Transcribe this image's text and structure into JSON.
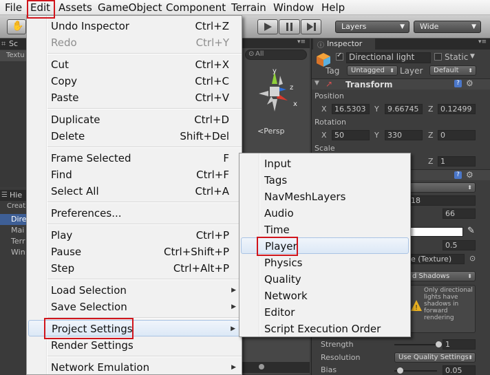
{
  "menubar": {
    "items": [
      "File",
      "Edit",
      "Assets",
      "GameObject",
      "Component",
      "Terrain",
      "Window",
      "Help"
    ]
  },
  "toolbar": {
    "layers_label": "Layers",
    "layout_label": "Wide"
  },
  "left_panels": {
    "scene_tab": "Sc",
    "scene_sub": "Textu",
    "hierarchy_tab": "Hie",
    "hierarchy_create": "Creat",
    "hierarchy_items": [
      "Dire",
      "Mai",
      "Terr",
      "Win"
    ]
  },
  "scene_view": {
    "search_placeholder": "All",
    "axis_y": "y",
    "axis_z": "z",
    "axis_x": "x",
    "persp_label": "Persp"
  },
  "inspector": {
    "tab_title": "Inspector",
    "object_name": "Directional light",
    "static_label": "Static",
    "tag_label": "Tag",
    "tag_value": "Untagged",
    "layer_label": "Layer",
    "layer_value": "Default",
    "transform_title": "Transform",
    "position_label": "Position",
    "position": {
      "x": "16.5303",
      "y": "9.66745",
      "z": "0.12499"
    },
    "rotation_label": "Rotation",
    "rotation": {
      "x": "50",
      "y": "330",
      "z": "0"
    },
    "scale_label": "Scale",
    "scale_z": "1",
    "light_range_value": "18",
    "intensity_value": "66",
    "spot_value": "0.5",
    "cookie_texture": "e (Texture)",
    "shadows_value": "d Shadows",
    "shadow_warning": "Only directional lights have shadows in forward rendering",
    "strength_label": "Strength",
    "strength_value": "1",
    "resolution_label": "Resolution",
    "resolution_value": "Use Quality Settings",
    "bias_label": "Bias",
    "bias_value": "0.05"
  },
  "edit_menu": {
    "undo": {
      "label": "Undo Inspector",
      "shortcut": "Ctrl+Z"
    },
    "redo": {
      "label": "Redo",
      "shortcut": "Ctrl+Y"
    },
    "cut": {
      "label": "Cut",
      "shortcut": "Ctrl+X"
    },
    "copy": {
      "label": "Copy",
      "shortcut": "Ctrl+C"
    },
    "paste": {
      "label": "Paste",
      "shortcut": "Ctrl+V"
    },
    "duplicate": {
      "label": "Duplicate",
      "shortcut": "Ctrl+D"
    },
    "delete": {
      "label": "Delete",
      "shortcut": "Shift+Del"
    },
    "frame_selected": {
      "label": "Frame Selected",
      "shortcut": "F"
    },
    "find": {
      "label": "Find",
      "shortcut": "Ctrl+F"
    },
    "select_all": {
      "label": "Select All",
      "shortcut": "Ctrl+A"
    },
    "preferences": {
      "label": "Preferences..."
    },
    "play": {
      "label": "Play",
      "shortcut": "Ctrl+P"
    },
    "pause": {
      "label": "Pause",
      "shortcut": "Ctrl+Shift+P"
    },
    "step": {
      "label": "Step",
      "shortcut": "Ctrl+Alt+P"
    },
    "load_selection": {
      "label": "Load Selection"
    },
    "save_selection": {
      "label": "Save Selection"
    },
    "project_settings": {
      "label": "Project Settings"
    },
    "render_settings": {
      "label": "Render Settings"
    },
    "network_emulation": {
      "label": "Network Emulation"
    }
  },
  "project_settings_menu": {
    "items": [
      "Input",
      "Tags",
      "NavMeshLayers",
      "Audio",
      "Time",
      "Player",
      "Physics",
      "Quality",
      "Network",
      "Editor",
      "Script Execution Order"
    ],
    "selected": "Player"
  },
  "colors": {
    "highlight_box": "#d0141b",
    "menu_bg": "#f1f1f1",
    "menu_hover": "#dce8f6",
    "inspector_bg": "#3d3d3d"
  }
}
